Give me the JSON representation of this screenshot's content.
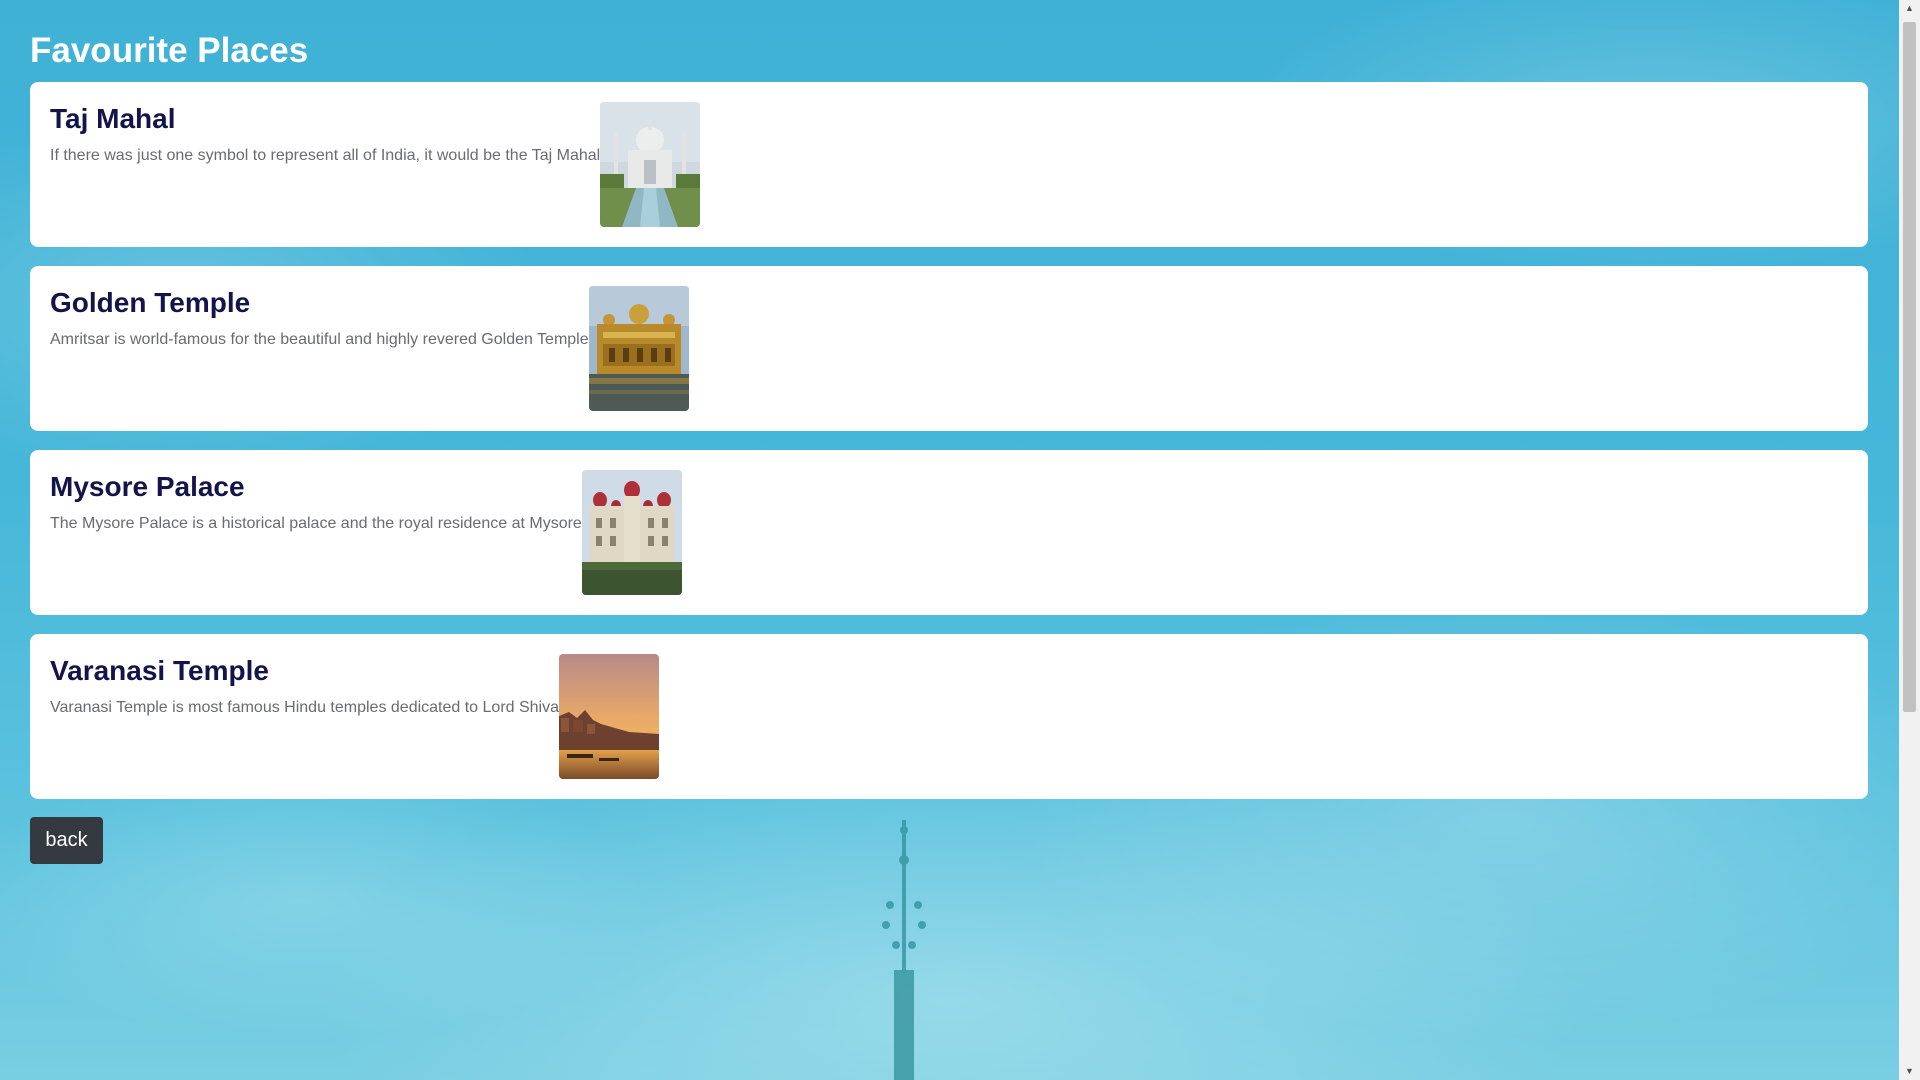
{
  "page": {
    "title": "Favourite Places"
  },
  "places": [
    {
      "name": "Taj Mahal",
      "description": "If there was just one symbol to represent all of India, it would be the Taj Mahal",
      "image": "taj-mahal-photo"
    },
    {
      "name": "Golden Temple",
      "description": "Amritsar is world-famous for the beautiful and highly revered Golden Temple",
      "image": "golden-temple-photo"
    },
    {
      "name": "Mysore Palace",
      "description": "The Mysore Palace is a historical palace and the royal residence at Mysore",
      "image": "mysore-palace-photo"
    },
    {
      "name": "Varanasi Temple",
      "description": "Varanasi Temple is most famous Hindu temples dedicated to Lord Shiva",
      "image": "varanasi-ghat-photo"
    }
  ],
  "actions": {
    "back_label": "back"
  },
  "colors": {
    "background": "#46b7d9",
    "card": "#ffffff",
    "title_text": "#13144a",
    "description_text": "#6a6a72",
    "back_button": "#343a40"
  }
}
